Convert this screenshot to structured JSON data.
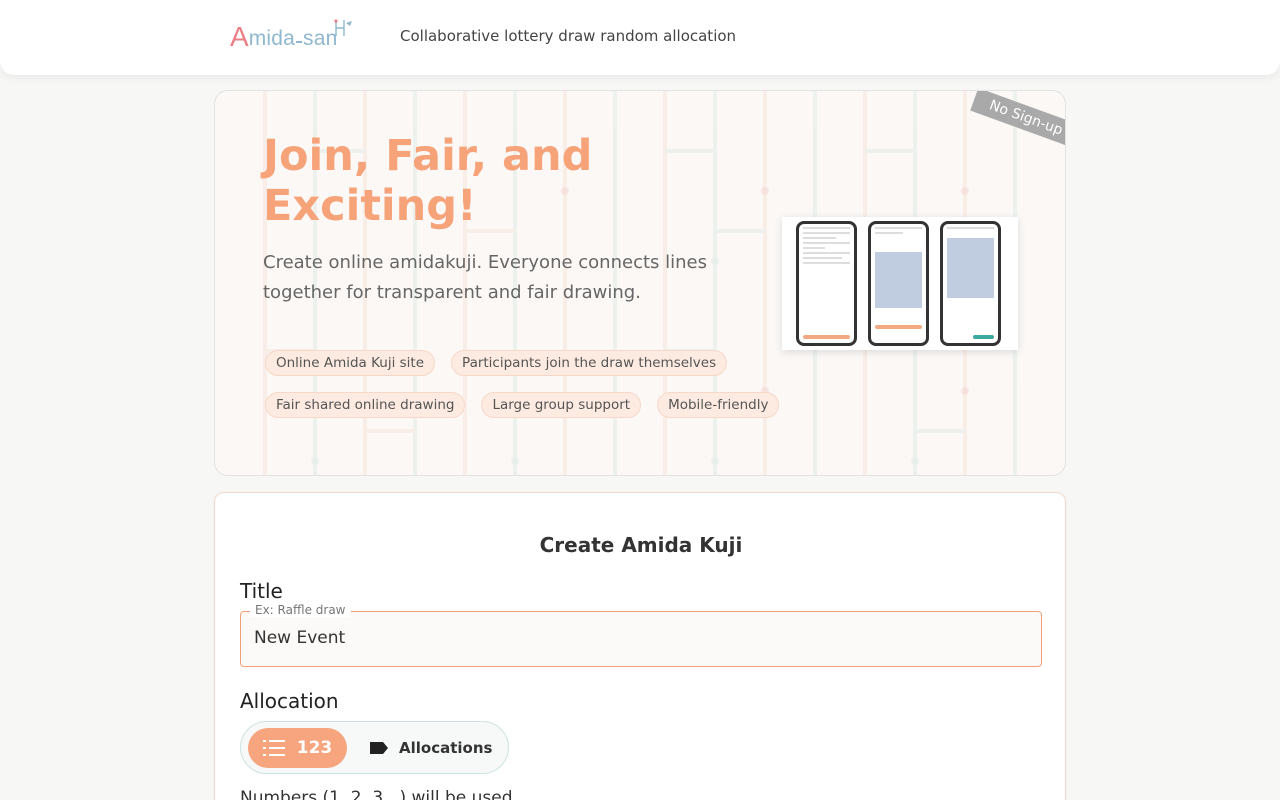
{
  "header": {
    "logo_initial": "A",
    "logo_mid": "mida",
    "logo_end": "san",
    "tagline": "Collaborative lottery draw random allocation"
  },
  "hero": {
    "title": "Join, Fair, and Exciting!",
    "description": "Create online amidakuji. Everyone connects lines together for transparent and fair drawing.",
    "chips_row1": [
      "Online Amida Kuji site",
      "Participants join the draw themselves"
    ],
    "chips_row2": [
      "Fair shared online drawing",
      "Large group support",
      "Mobile-friendly"
    ],
    "ribbon": "No Sign-up"
  },
  "form": {
    "heading": "Create Amida Kuji",
    "title_label": "Title",
    "title_placeholder": "Ex: Raffle draw",
    "title_value": "New Event",
    "allocation_label": "Allocation",
    "toggle_numbers": "123",
    "toggle_allocations": "Allocations",
    "allocation_note": "Numbers (1, 2, 3...) will be used"
  },
  "colors": {
    "accent": "#f6a57f",
    "title": "#f7a37a",
    "logo_red": "#ec7f86",
    "logo_blue": "#8fb8cf"
  },
  "icons": {
    "numbered_list": "list-numbered-icon",
    "allocation_tag": "label-tag-icon"
  }
}
